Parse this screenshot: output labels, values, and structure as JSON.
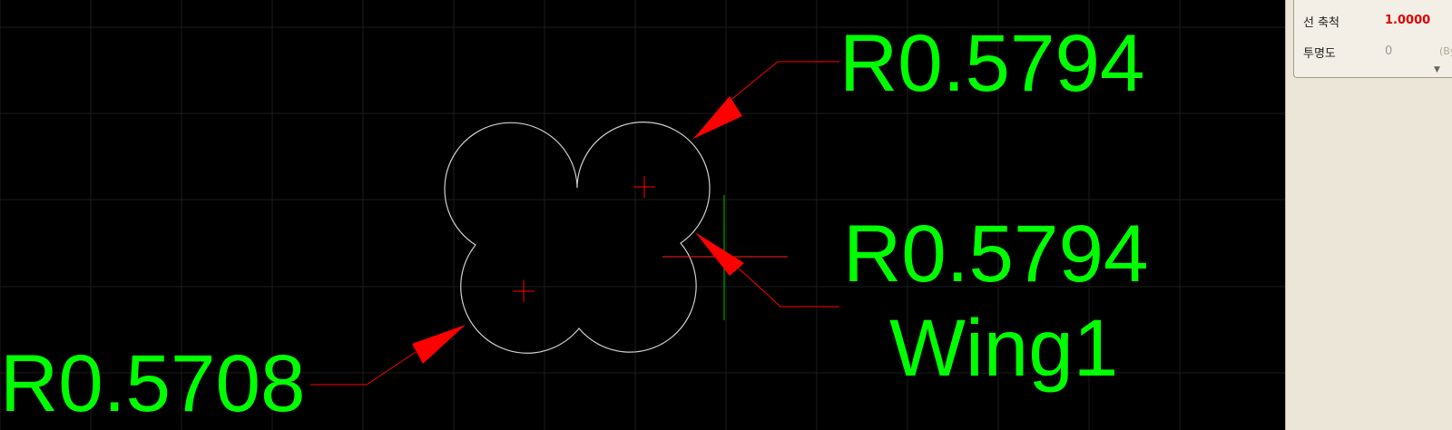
{
  "drawing": {
    "dimensions": [
      {
        "text": "R0.5794"
      },
      {
        "text": "R0.5794"
      },
      {
        "text": "Wing1"
      },
      {
        "text": "R0.5708"
      }
    ],
    "colors": {
      "background": "#000000",
      "grid": "#1c1c1c",
      "geometry": "#cfcfcf",
      "dimension_text": "#00ff00",
      "leader": "#ff0000",
      "center_mark": "#ff0000",
      "cursor": "#00c000"
    }
  },
  "properties": {
    "rows": [
      {
        "label": "선 축척",
        "value": "1.0000"
      },
      {
        "label": "투명도",
        "value": "0",
        "extra": "(ByL"
      }
    ],
    "expand_icon": "chevron-down-icon"
  }
}
